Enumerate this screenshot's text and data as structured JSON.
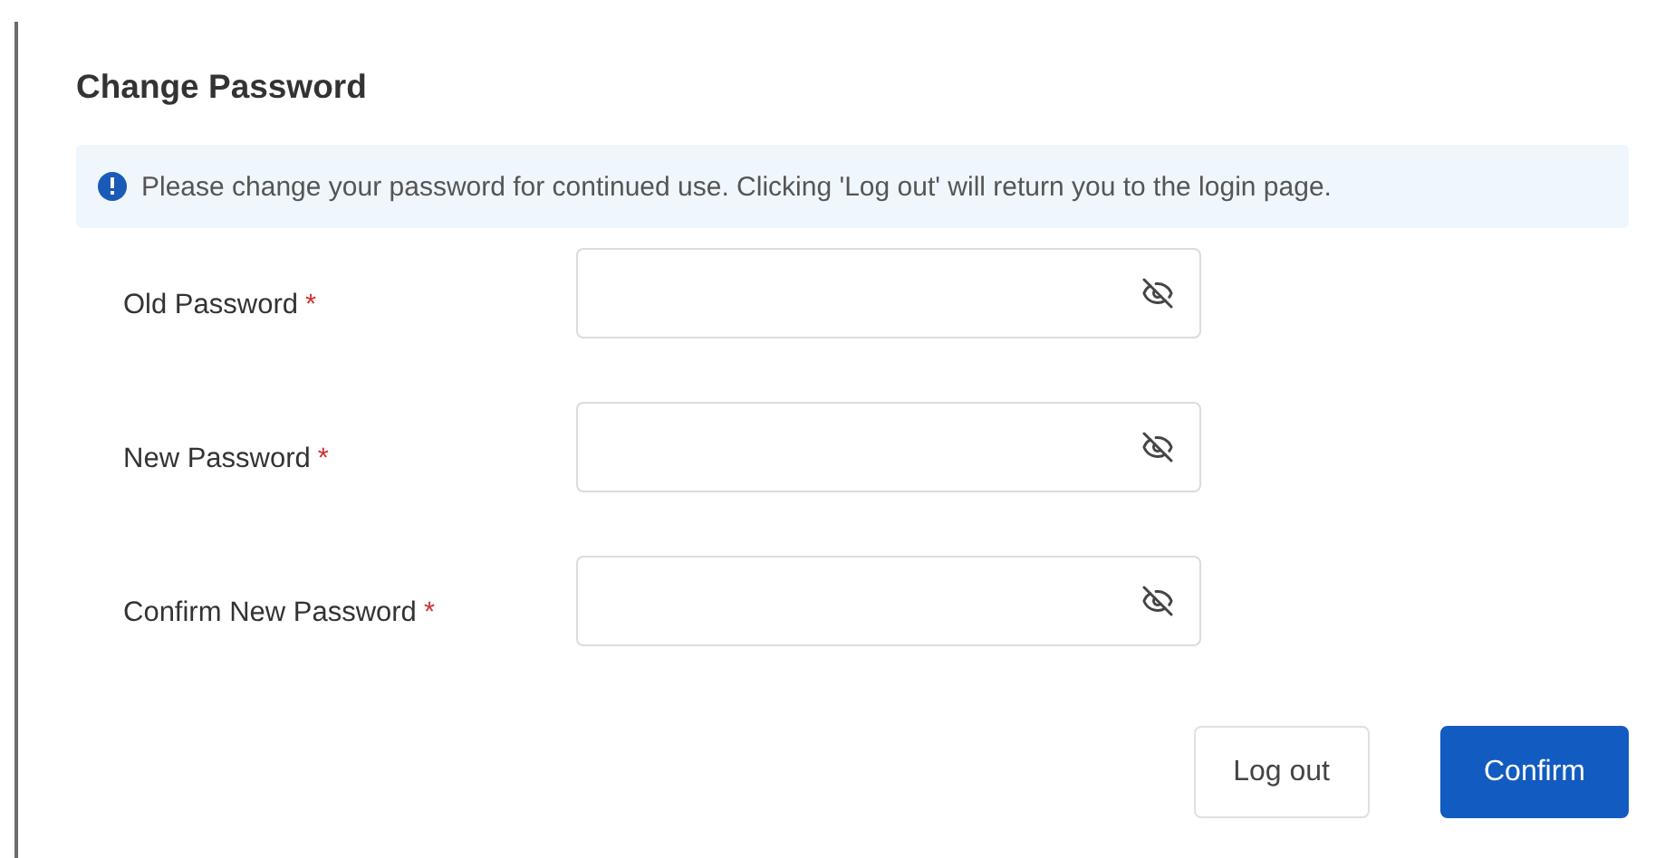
{
  "title": "Change Password",
  "notice": {
    "text": "Please change your password for continued use. Clicking 'Log out' will return you to the login page."
  },
  "fields": [
    {
      "label": "Old Password",
      "required_mark": "*"
    },
    {
      "label": "New Password",
      "required_mark": "*"
    },
    {
      "label": "Confirm New Password",
      "required_mark": "*"
    }
  ],
  "buttons": [
    {
      "label": "Log out",
      "kind": "secondary"
    },
    {
      "label": "Confirm",
      "kind": "primary"
    }
  ]
}
